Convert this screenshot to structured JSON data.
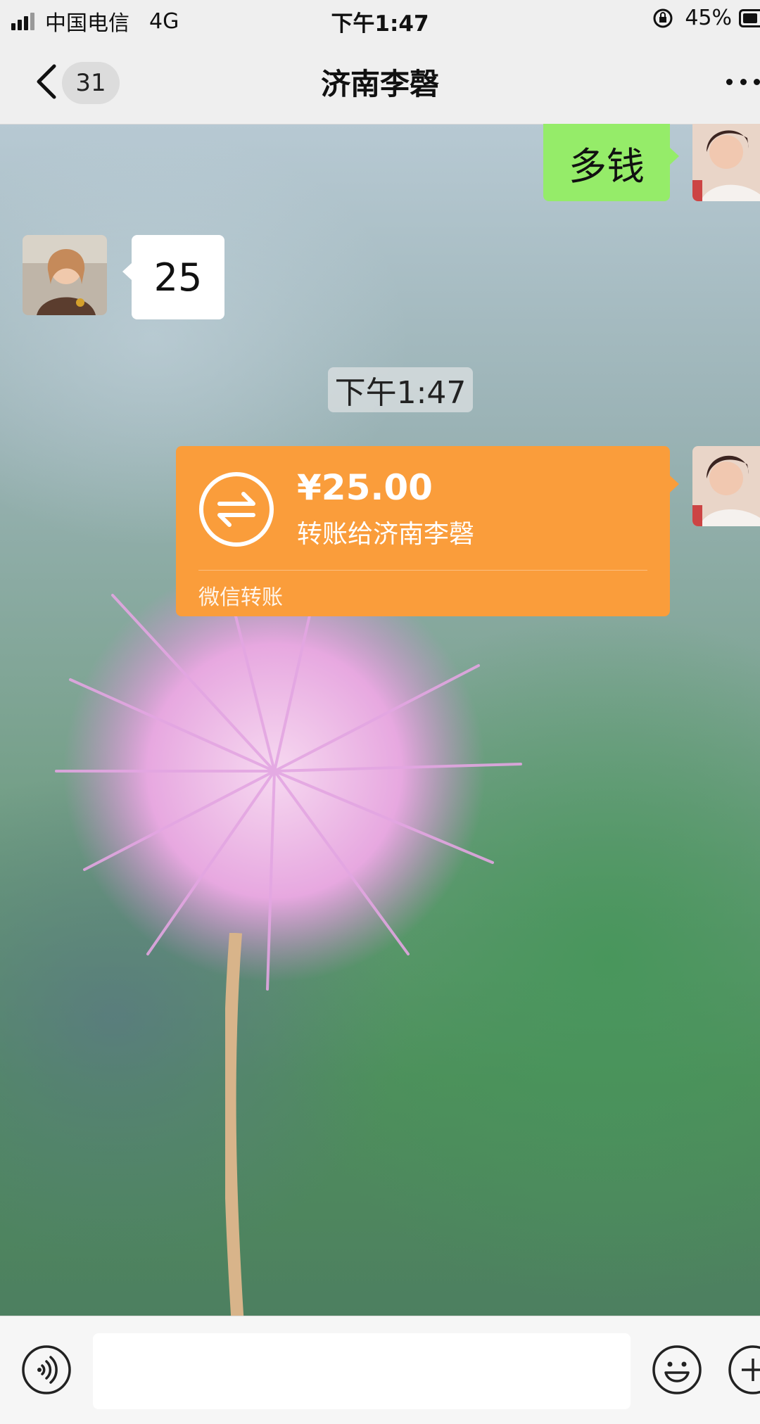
{
  "status_bar": {
    "carrier": "中国电信",
    "network": "4G",
    "time": "下午1:47",
    "battery": "45%"
  },
  "nav": {
    "unread_count": "31",
    "title": "济南李磬"
  },
  "messages": {
    "m1": {
      "direction": "sent",
      "text": "多钱"
    },
    "m2": {
      "direction": "received",
      "text": "25"
    },
    "timestamp": "下午1:47",
    "transfer": {
      "direction": "sent",
      "amount": "¥25.00",
      "description": "转账给济南李磬",
      "brand": "微信转账"
    }
  },
  "input_bar": {
    "value": "",
    "placeholder": ""
  },
  "colors": {
    "sent_bubble": "#95ec69",
    "received_bubble": "#ffffff",
    "transfer_card": "#fa9d3b",
    "bar_background": "#efefef"
  },
  "icons": [
    "back-chevron-icon",
    "more-dots-icon",
    "transfer-arrows-icon",
    "voice-icon",
    "emoji-icon",
    "plus-icon",
    "lock-rotation-icon",
    "signal-icon",
    "battery-icon"
  ]
}
